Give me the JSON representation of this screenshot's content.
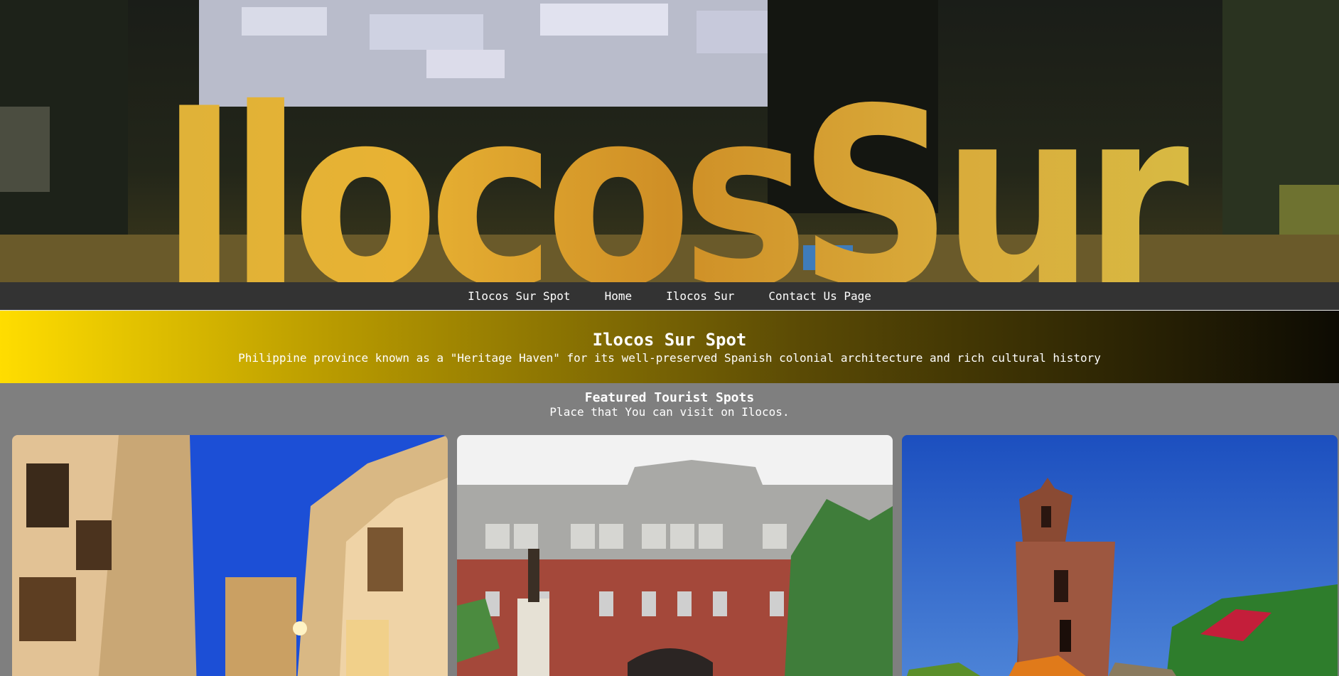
{
  "hero": {
    "title": "IlocosSur"
  },
  "nav": {
    "items": [
      "Ilocos Sur Spot",
      "Home",
      "Ilocos Sur",
      "Contact Us Page"
    ]
  },
  "header": {
    "title": "Ilocos Sur Spot",
    "subtitle": "Philippine province known as a \"Heritage Haven\" for its well-preserved Spanish colonial architecture and rich cultural history"
  },
  "featured": {
    "title": "Featured Tourist Spots",
    "subtitle": "Place that You can visit on Ilocos."
  },
  "colors": {
    "nav_bg": "#333333",
    "band_start": "#ffdd00",
    "band_end": "#0d0b03",
    "page_bg": "#7f7f7f"
  }
}
